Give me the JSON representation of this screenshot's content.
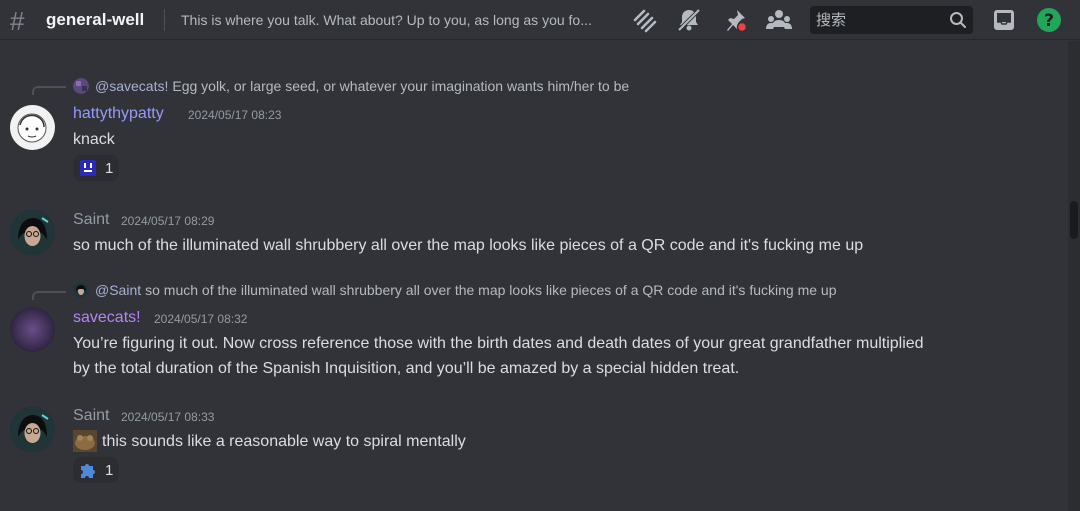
{
  "header": {
    "channel_name": "general-well",
    "topic": "This is where you talk. What about? Up to you, as long as you fo...",
    "search_placeholder": "搜索",
    "icons": [
      "threads-icon",
      "mute-bell-icon",
      "pin-icon",
      "members-icon",
      "search-icon",
      "inbox-icon",
      "help-icon"
    ]
  },
  "messages": [
    {
      "reply_to_user": "@savecats!",
      "reply_text": "Egg yolk, or large seed, or whatever your imagination wants him/her to be",
      "username": "hattythypatty",
      "username_color": "#949cf7",
      "timestamp": "2024/05/17 08:23",
      "text": "knack",
      "reaction_count": "1"
    },
    {
      "username": "Saint",
      "username_color": "#949ba4",
      "timestamp": "2024/05/17 08:29",
      "text": "so much of the illuminated wall shrubbery all over the map looks like pieces of a QR code and it's fucking me up"
    },
    {
      "reply_to_user": "@Saint",
      "reply_text": "so much of the illuminated wall shrubbery all over the map looks like pieces of a QR code and it's fucking me up",
      "username": "savecats!",
      "username_color": "#b685f5",
      "timestamp": "2024/05/17 08:32",
      "text_line1": "You’re figuring it out. Now cross reference those with the birth dates and death dates of your great grandfather multiplied",
      "text_line2": "by the total duration of the Spanish Inquisition, and you’ll be amazed by a special hidden treat."
    },
    {
      "username": "Saint",
      "username_color": "#949ba4",
      "timestamp": "2024/05/17 08:33",
      "text": "this sounds like a reasonable way to spiral mentally",
      "reaction_count": "1"
    }
  ],
  "colors": {
    "background": "#313338",
    "header_icon": "#b5bac1",
    "notification_red": "#f23f43",
    "help_green": "#23a55a"
  }
}
